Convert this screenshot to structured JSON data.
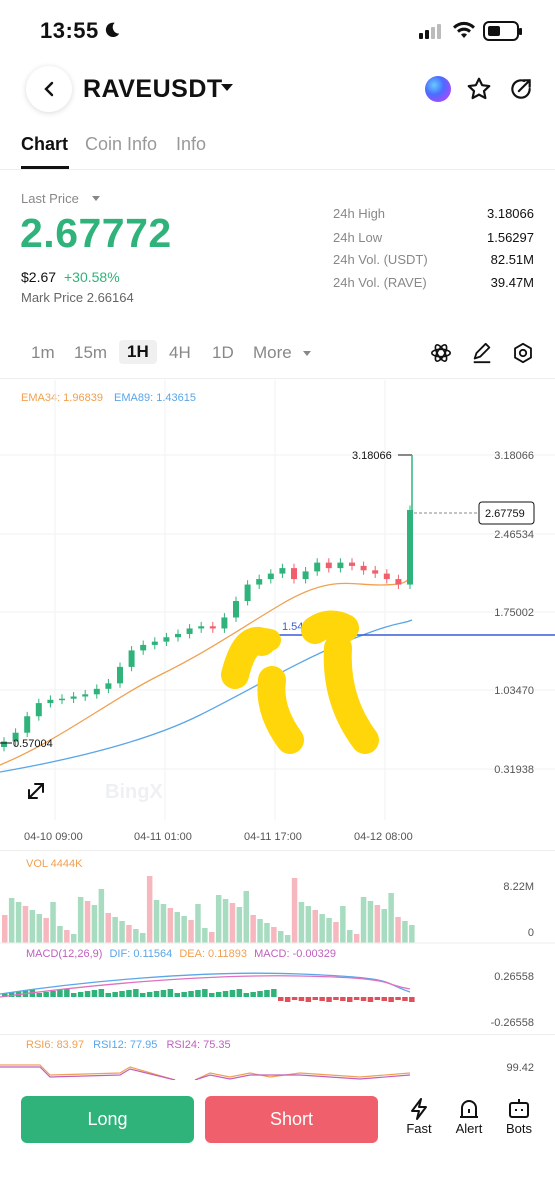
{
  "status": {
    "time": "13:55"
  },
  "header": {
    "pair": "RAVEUSDT"
  },
  "tabs": [
    "Chart",
    "Coin Info",
    "Info"
  ],
  "ticker": {
    "last_price_label": "Last Price",
    "last_price": "2.67772",
    "usd_price": "$2.67",
    "change": "+30.58%",
    "mark_price": "Mark Price 2.66164",
    "stats": [
      {
        "label": "24h High",
        "value": "3.18066"
      },
      {
        "label": "24h Low",
        "value": "1.56297"
      },
      {
        "label": "24h Vol. (USDT)",
        "value": "82.51M"
      },
      {
        "label": "24h Vol. (RAVE)",
        "value": "39.47M"
      }
    ]
  },
  "timeframes": [
    "1m",
    "15m",
    "1H",
    "4H",
    "1D",
    "More"
  ],
  "chart": {
    "ema34": "EMA34: 1.96839",
    "ema89": "EMA89: 1.43615",
    "y_ticks": [
      "3.18066",
      "2.46534",
      "1.75002",
      "1.03470",
      "0.31938"
    ],
    "high_label": "3.18066",
    "low_label": "0.57004",
    "current_label": "2.67759",
    "line_label": "1.544",
    "watermark": "BingX",
    "x_ticks": [
      "04-10 09:00",
      "04-11 01:00",
      "04-11 17:00",
      "04-12 08:00"
    ]
  },
  "chart_data": {
    "type": "candlestick",
    "x_ticks": [
      "04-10 09:00",
      "04-11 01:00",
      "04-11 17:00",
      "04-12 08:00"
    ],
    "ylim": [
      0.31938,
      3.18066
    ],
    "close_series_approx": [
      0.57,
      0.65,
      0.8,
      0.92,
      0.95,
      0.96,
      0.98,
      1.0,
      1.05,
      1.1,
      1.25,
      1.4,
      1.45,
      1.48,
      1.52,
      1.55,
      1.6,
      1.62,
      1.6,
      1.7,
      1.85,
      2.0,
      2.05,
      2.1,
      2.15,
      2.05,
      2.12,
      2.2,
      2.15,
      2.2,
      2.17,
      2.13,
      2.1,
      2.05,
      2.0,
      2.68
    ]
  },
  "volume": {
    "label": "VOL 4444K",
    "ticks": [
      "8.22M",
      "0"
    ]
  },
  "macd": {
    "label": "MACD(12,26,9)",
    "dif": "DIF: 0.11564",
    "dea": "DEA: 0.11893",
    "macd": "MACD: -0.00329",
    "ticks": [
      "0.26558",
      "-0.26558"
    ]
  },
  "rsi": {
    "rsi6": "RSI6: 83.97",
    "rsi12": "RSI12: 77.95",
    "rsi24": "RSI24: 75.35",
    "tick": "99.42"
  },
  "actions": {
    "long": "Long",
    "short": "Short",
    "fast": "Fast",
    "alert": "Alert",
    "bots": "Bots"
  },
  "colors": {
    "green": "#2fb37a",
    "red": "#f0606c",
    "ema34": "#f0a050",
    "ema89": "#5aa6e8",
    "blue_line": "#3a5bd9"
  }
}
